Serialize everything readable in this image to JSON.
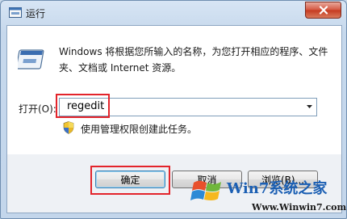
{
  "window": {
    "title": "运行",
    "icon": "run-window-icon"
  },
  "dialog": {
    "description": "Windows 将根据您所输入的名称，为您打开相应的程序、文件夹、文档或 Internet 资源。",
    "open_label": "打开(O):",
    "command_value": "regedit",
    "admin_note": "使用管理权限创建此任务。"
  },
  "buttons": {
    "ok": "确定",
    "cancel": "取消",
    "browse": "浏览(B)..."
  },
  "watermark": {
    "brand": "Win7系统之家",
    "url": "Www.Winwin7.com"
  },
  "colors": {
    "highlight": "#e3242b",
    "accent": "#1b5fb3"
  }
}
